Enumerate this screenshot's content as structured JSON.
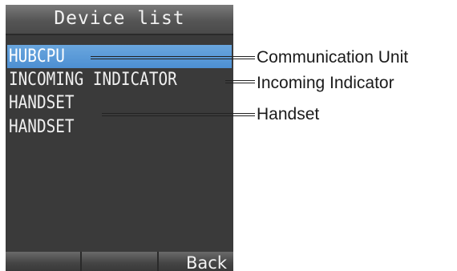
{
  "screen": {
    "title": "Device list",
    "items": [
      {
        "label": "HUBCPU",
        "selected": true
      },
      {
        "label": "INCOMING INDICATOR",
        "selected": false
      },
      {
        "label": "HANDSET",
        "selected": false
      },
      {
        "label": "HANDSET",
        "selected": false
      }
    ],
    "softkeys": [
      "",
      "",
      "Back"
    ],
    "colors": {
      "selection": "#5a9ad8",
      "background": "#3a3a3a"
    }
  },
  "callouts": [
    {
      "text": "Communication Unit"
    },
    {
      "text": "Incoming Indicator"
    },
    {
      "text": "Handset"
    }
  ]
}
